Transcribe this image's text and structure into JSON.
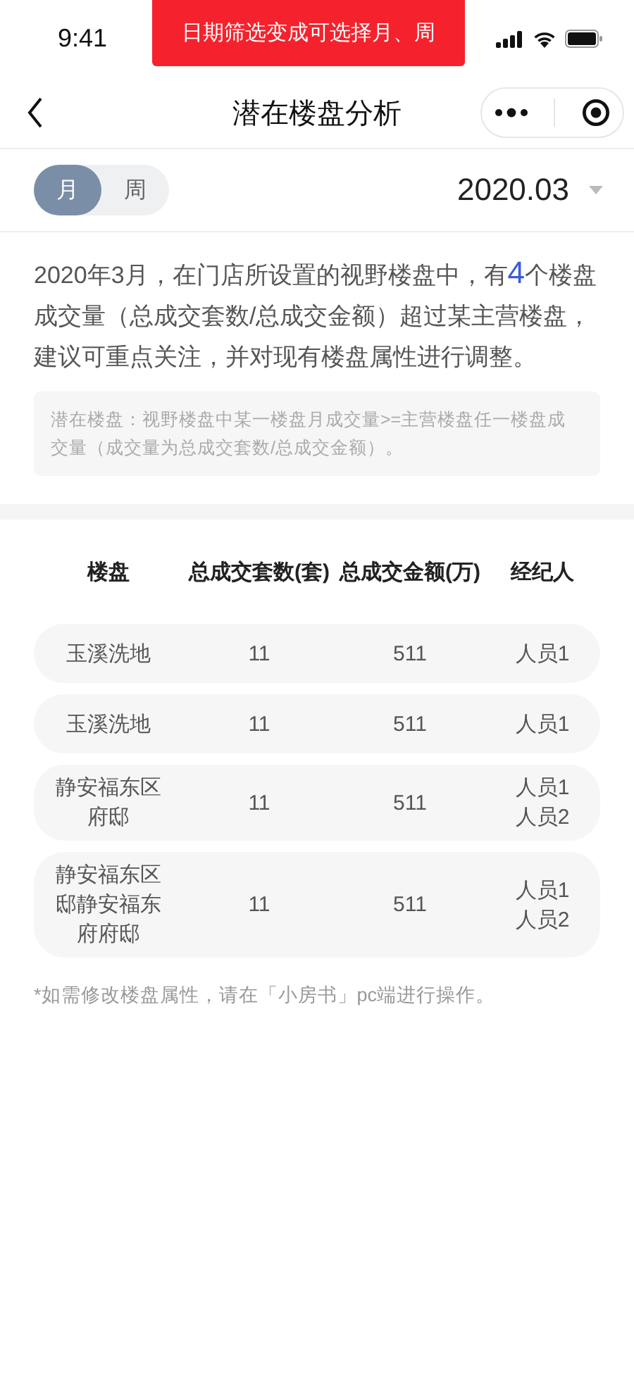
{
  "status_bar": {
    "time": "9:41"
  },
  "toast": {
    "text": "日期筛选变成可选择月、周"
  },
  "nav": {
    "title": "潜在楼盘分析"
  },
  "period_tabs": [
    {
      "label": "月",
      "selected": true
    },
    {
      "label": "周",
      "selected": false
    }
  ],
  "date_picker": {
    "value": "2020.03"
  },
  "summary": "2020年3月，在门店所设置的视野楼盘中，有**4**个楼盘成交量（总成交套数/总成交金额）超过某主营楼盘，建议可重点关注，并对现有楼盘属性进行调整。",
  "definition": "潜在楼盘：视野楼盘中某一楼盘月成交量>=主营楼盘任一楼盘成交量（成交量为总成交套数/总成交金额）。",
  "table": {
    "columns": [
      "楼盘",
      "总成交套数(套)",
      "总成交金额(万)",
      "经纪人"
    ],
    "rows": [
      {
        "name": "玉溪洗地",
        "units": "11",
        "amount": "511",
        "agents": [
          "人员1"
        ]
      },
      {
        "name": "玉溪洗地",
        "units": "11",
        "amount": "511",
        "agents": [
          "人员1"
        ]
      },
      {
        "name": "静安福东区府邸",
        "units": "11",
        "amount": "511",
        "agents": [
          "人员1",
          "人员2"
        ]
      },
      {
        "name": "静安福东区邸静安福东府府邸",
        "units": "11",
        "amount": "511",
        "agents": [
          "人员1",
          "人员2"
        ]
      }
    ]
  },
  "footnote": "*如需修改楼盘属性，请在「小房书」pc端进行操作。"
}
